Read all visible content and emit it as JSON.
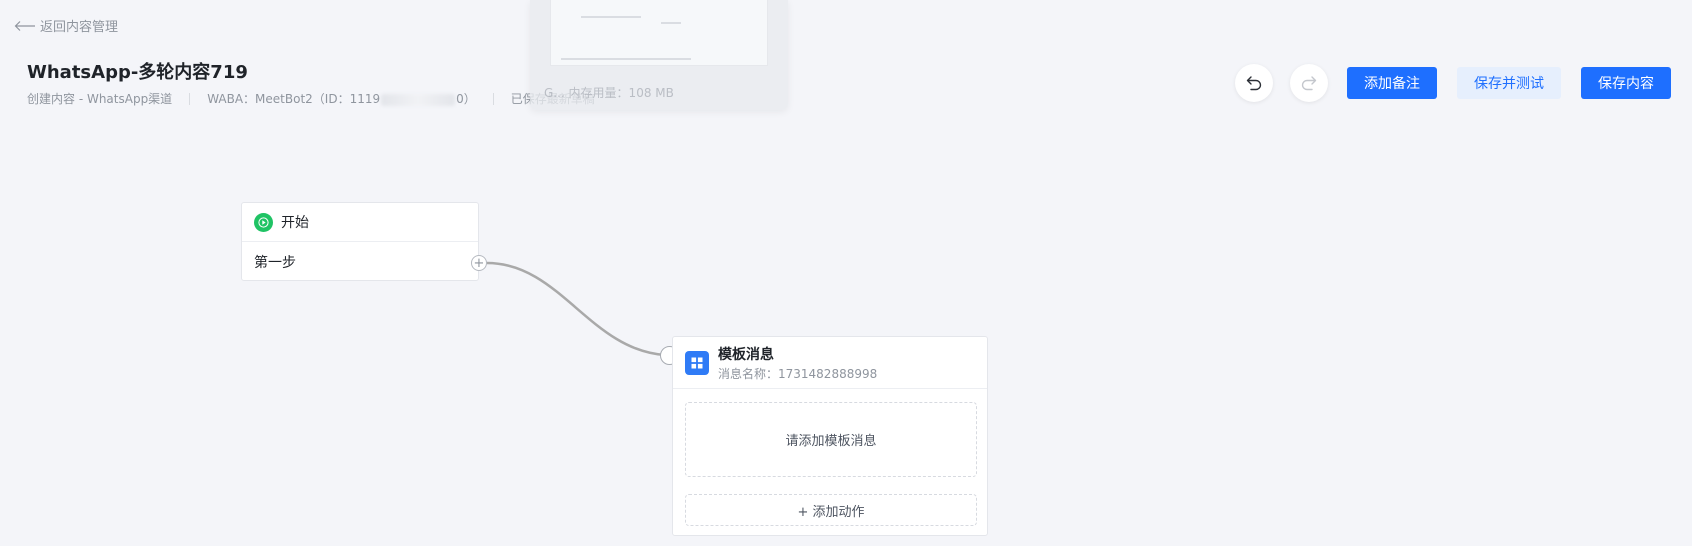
{
  "header": {
    "back_label": "返回内容管理",
    "title": "WhatsApp-多轮内容719",
    "meta_created": "创建内容 - WhatsApp渠道",
    "meta_waba_prefix": "WABA：MeetBot2（ID：1119",
    "meta_waba_suffix": "0）",
    "meta_saved": "已保存最新草稿"
  },
  "overlay": {
    "text": "G... 内存用量：108 MB"
  },
  "toolbar": {
    "undo_icon": "undo-icon",
    "redo_icon": "redo-icon",
    "add_note_label": "添加备注",
    "save_test_label": "保存并测试",
    "save_label": "保存内容"
  },
  "nodes": {
    "start": {
      "label": "开始",
      "step_label": "第一步",
      "add_handle": "+"
    },
    "template": {
      "title": "模板消息",
      "subtitle": "消息名称：1731482888998",
      "placeholder": "请添加模板消息",
      "add_action_label": "+ 添加动作"
    }
  },
  "colors": {
    "primary": "#1e6fff",
    "primary_light": "#e6effd",
    "start_green": "#1fc364",
    "template_blue": "#2f7bf6",
    "canvas_bg": "#f4f5f9",
    "connector": "#a9a9a9"
  }
}
